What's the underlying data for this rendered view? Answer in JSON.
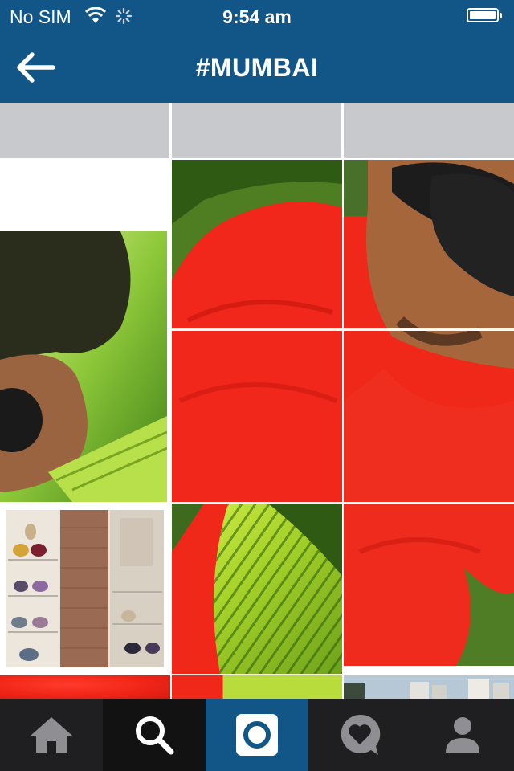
{
  "status_bar": {
    "carrier": "No SIM",
    "time": "9:54 am",
    "icons": [
      "wifi-icon",
      "activity-spinner-icon",
      "battery-icon"
    ]
  },
  "nav": {
    "back_icon": "back-arrow-icon",
    "title": "#MUMBAI"
  },
  "grid": {
    "columns": 3,
    "photos": [
      {
        "subject": "partial-top-row"
      },
      {
        "subject": "man-red-shirt-sunglasses"
      },
      {
        "subject": "man-sunglasses-foliage"
      },
      {
        "subject": "handbag-shop-display"
      },
      {
        "subject": "palm-leaf-red-shirt"
      },
      {
        "subject": "city-skyline"
      }
    ]
  },
  "tab_bar": {
    "tabs": [
      {
        "name": "home",
        "icon": "home-icon",
        "active": false
      },
      {
        "name": "explore",
        "icon": "search-icon",
        "active": true
      },
      {
        "name": "camera",
        "icon": "camera-icon",
        "active": false
      },
      {
        "name": "activity",
        "icon": "activity-heart-icon",
        "active": false
      },
      {
        "name": "profile",
        "icon": "profile-icon",
        "active": false
      }
    ]
  },
  "colors": {
    "brand_blue": "#125688",
    "tab_bar": "#1f1f21",
    "placeholder_gray": "#c8c9cc"
  }
}
